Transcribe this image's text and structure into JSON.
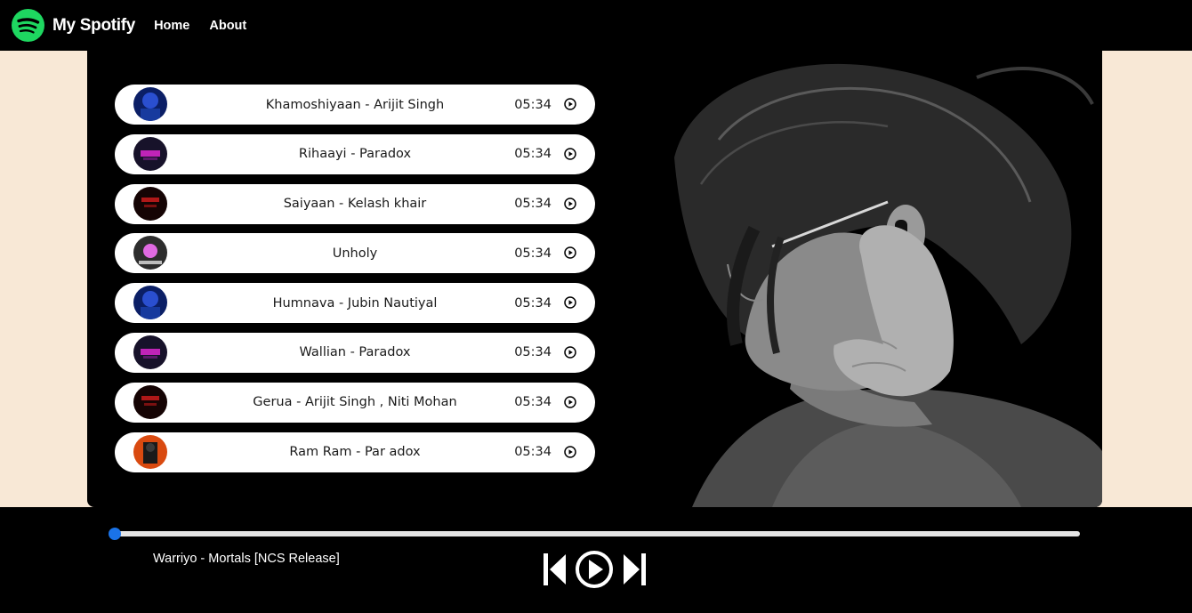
{
  "nav": {
    "brand": "My Spotify",
    "links": [
      "Home",
      "About"
    ]
  },
  "songs": [
    {
      "name": "Khamoshiyaan - Arijit Singh",
      "duration": "05:34",
      "cover_colors": [
        "#0b1f66",
        "#2a4fd0"
      ]
    },
    {
      "name": "Rihaayi - Paradox",
      "duration": "05:34",
      "cover_colors": [
        "#17122a",
        "#c024b8"
      ]
    },
    {
      "name": "Saiyaan - Kelash khair",
      "duration": "05:34",
      "cover_colors": [
        "#150404",
        "#b01818"
      ]
    },
    {
      "name": "Unholy",
      "duration": "05:34",
      "cover_colors": [
        "#2d2d2d",
        "#e06ae2"
      ]
    },
    {
      "name": "Humnava - Jubin Nautiyal",
      "duration": "05:34",
      "cover_colors": [
        "#0b1f66",
        "#2a4fd0"
      ]
    },
    {
      "name": "Wallian - Paradox",
      "duration": "05:34",
      "cover_colors": [
        "#17122a",
        "#c024b8"
      ]
    },
    {
      "name": "Gerua - Arijit Singh , Niti Mohan",
      "duration": "05:34",
      "cover_colors": [
        "#150404",
        "#b01818"
      ]
    },
    {
      "name": "Ram Ram - Par adox",
      "duration": "05:34",
      "cover_colors": [
        "#d94a10",
        "#1a1a1a"
      ]
    }
  ],
  "player": {
    "now_playing": "Warriyo - Mortals [NCS Release]",
    "progress": 0,
    "accent_color": "#1a73e8",
    "icons": [
      "previous-icon",
      "play-circle-icon",
      "next-icon"
    ]
  },
  "colors": {
    "page_bg": "#f8e8d6",
    "nav_bg": "#000000",
    "spotify_green": "#1ed760"
  }
}
